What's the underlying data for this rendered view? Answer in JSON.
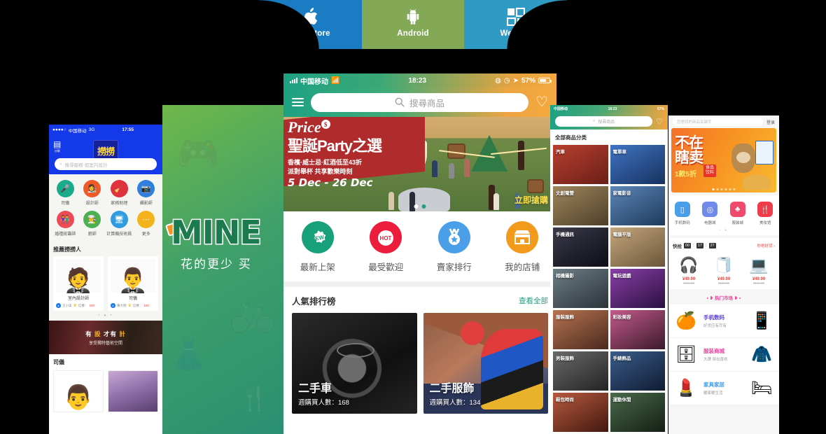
{
  "download_tabs": [
    {
      "label": "App Store",
      "icon": "apple-icon",
      "color": "#1a7dc4"
    },
    {
      "label": "Android",
      "icon": "android-icon",
      "color": "#84a956"
    },
    {
      "label": "WeChar",
      "icon": "qrcode-icon",
      "color": "#2f9bc4"
    }
  ],
  "phone_services": {
    "status": {
      "carrier": "中国移动",
      "network": "3G",
      "time": "17:55"
    },
    "logo": "撈撈",
    "menu_label": "分類",
    "search_placeholder": "搜尋服務‧如室内設計",
    "categories": [
      {
        "label": "司儀",
        "icon": "microphone-icon",
        "color": "#1aab8a"
      },
      {
        "label": "設計師",
        "icon": "designer-icon",
        "color": "#f05a28"
      },
      {
        "label": "家務助理",
        "icon": "broom-icon",
        "color": "#e0313f"
      },
      {
        "label": "攝影師",
        "icon": "camera-icon",
        "color": "#2f7fe0"
      },
      {
        "label": "婚禮統籌師",
        "icon": "couple-icon",
        "color": "#ef4a57"
      },
      {
        "label": "廚師",
        "icon": "chef-icon",
        "color": "#4caf50"
      },
      {
        "label": "計算機技術員",
        "icon": "computer-icon",
        "color": "#2f9be0"
      },
      {
        "label": "更多",
        "icon": "more-icon",
        "color": "#f5b31b"
      }
    ],
    "section_recommend": "推薦撈撈人",
    "people": [
      {
        "role": "室內設計師",
        "name": "王小美",
        "score_label": "信譽：",
        "score": "100",
        "avatar": "man-suit-icon"
      },
      {
        "role": "司儀",
        "name": "陳大明",
        "score_label": "信譽：",
        "score": "100",
        "avatar": "man-tux-icon"
      }
    ],
    "promo": {
      "line1_a": "有",
      "line1_b": "設",
      "line1_c": "才有",
      "line1_d": "計",
      "line2": "享受獨特藝術空間"
    },
    "section_mc": "司儀"
  },
  "phone_mine": {
    "brand": "MINE",
    "tagline": "花的更少  买"
  },
  "phone_main": {
    "status": {
      "carrier": "中国移动",
      "time": "18:23",
      "battery": "57%"
    },
    "search_placeholder": "搜尋商品",
    "banner": {
      "brand": "Price",
      "brand_badge": "$",
      "headline": "聖誕Party之選",
      "sub1": "香檳·威士忌·紅酒低至43折",
      "sub2": "派對舉杯 共享歡樂時刻",
      "dates": "5 Dec - 26 Dec",
      "cta": "立即搶購"
    },
    "quick_links": [
      {
        "label": "最新上架",
        "icon": "new-badge-icon",
        "badge": "NEW",
        "color": "#18a07b"
      },
      {
        "label": "最受歡迎",
        "icon": "hot-badge-icon",
        "badge": "HOT",
        "color": "#ec1c3c"
      },
      {
        "label": "賣家排行",
        "icon": "medal-icon",
        "color": "#4a9fe8"
      },
      {
        "label": "我的店铺",
        "icon": "shop-icon",
        "color": "#f29a1c"
      }
    ],
    "ranking": {
      "title": "人氣排行榜",
      "more": "查看全部",
      "cards": [
        {
          "title": "二手車",
          "sub": "週購買人數：168",
          "image": "car-steering-wheel"
        },
        {
          "title": "二手服飾",
          "sub": "週購買人數：134",
          "image": "fashion-model"
        }
      ]
    }
  },
  "phone_categories": {
    "status": {
      "carrier": "中国移动",
      "time": "18:23",
      "battery": "57%"
    },
    "search_placeholder": "搜尋商品",
    "title": "全部商品分类",
    "cells": [
      {
        "label": "汽車",
        "color": "#8a2b2b"
      },
      {
        "label": "電單車",
        "color": "#25518c"
      },
      {
        "label": "文創電營",
        "color": "#6d5a3c"
      },
      {
        "label": "家電影音",
        "color": "#2b4f78"
      },
      {
        "label": "手機通訊",
        "color": "#1b1b2b"
      },
      {
        "label": "電腦平版",
        "color": "#8a7356"
      },
      {
        "label": "相機攝影",
        "color": "#3d4a52"
      },
      {
        "label": "電玩遊戲",
        "color": "#5b2b6b"
      },
      {
        "label": "服裝服飾",
        "color": "#7b4a3c"
      },
      {
        "label": "彩妝美容",
        "color": "#6b3a52"
      },
      {
        "label": "男裝服飾",
        "color": "#4a4a4a"
      },
      {
        "label": "手錶飾品",
        "color": "#243a5c"
      },
      {
        "label": "鞋包時尚",
        "color": "#7a3a2b"
      },
      {
        "label": "運動休閒",
        "color": "#2b3a2b"
      }
    ]
  },
  "phone_shop": {
    "search_placeholder": "您想找的商品关键字",
    "login": "登录",
    "hero": {
      "line1": "不在",
      "line2": "瞎卖",
      "line3": "1款5折",
      "tag_top": "食品",
      "tag_bottom": "饮料"
    },
    "icons": [
      {
        "label": "手机数码",
        "icon": "phone-icon",
        "color": "#4a9fe8"
      },
      {
        "label": "电器城",
        "icon": "washer-icon",
        "color": "#6f8ae8"
      },
      {
        "label": "服装城",
        "icon": "dress-icon",
        "color": "#ef4a6b"
      },
      {
        "label": "美妆馆",
        "icon": "cosmetics-icon",
        "color": "#ef3b4a"
      }
    ],
    "flash": {
      "label": "快抢",
      "hours": "00",
      "minutes": "17",
      "seconds": "27",
      "more": "秒抢好货 ›",
      "products": [
        {
          "icon": "earphones-icon",
          "price": "¥49.90",
          "original": "¥112.00"
        },
        {
          "icon": "tissue-box-icon",
          "price": "¥49.90",
          "original": "¥112.00"
        },
        {
          "icon": "laptop-icon",
          "price": "¥49.90",
          "original": "¥112.00"
        }
      ]
    },
    "hot_title": "• ❥ 热门市场 ❥ •",
    "markets": [
      {
        "title": "手机数码",
        "sub": "好货应有尽有",
        "left_icon": "oranges-icon",
        "right_icon": "smartphone-icon",
        "color": "#5b3fd8"
      },
      {
        "title": "服装商城",
        "sub": "大牌 穿出喜欢",
        "left_icon": "fridge-icon",
        "right_icon": "denim-jacket-icon",
        "color": "#e8449b"
      },
      {
        "title": "家具家居",
        "sub": "暖家暖生活",
        "left_icon": "lipstick-icon",
        "right_icon": "bed-icon",
        "color": "#3f9be8"
      }
    ]
  }
}
